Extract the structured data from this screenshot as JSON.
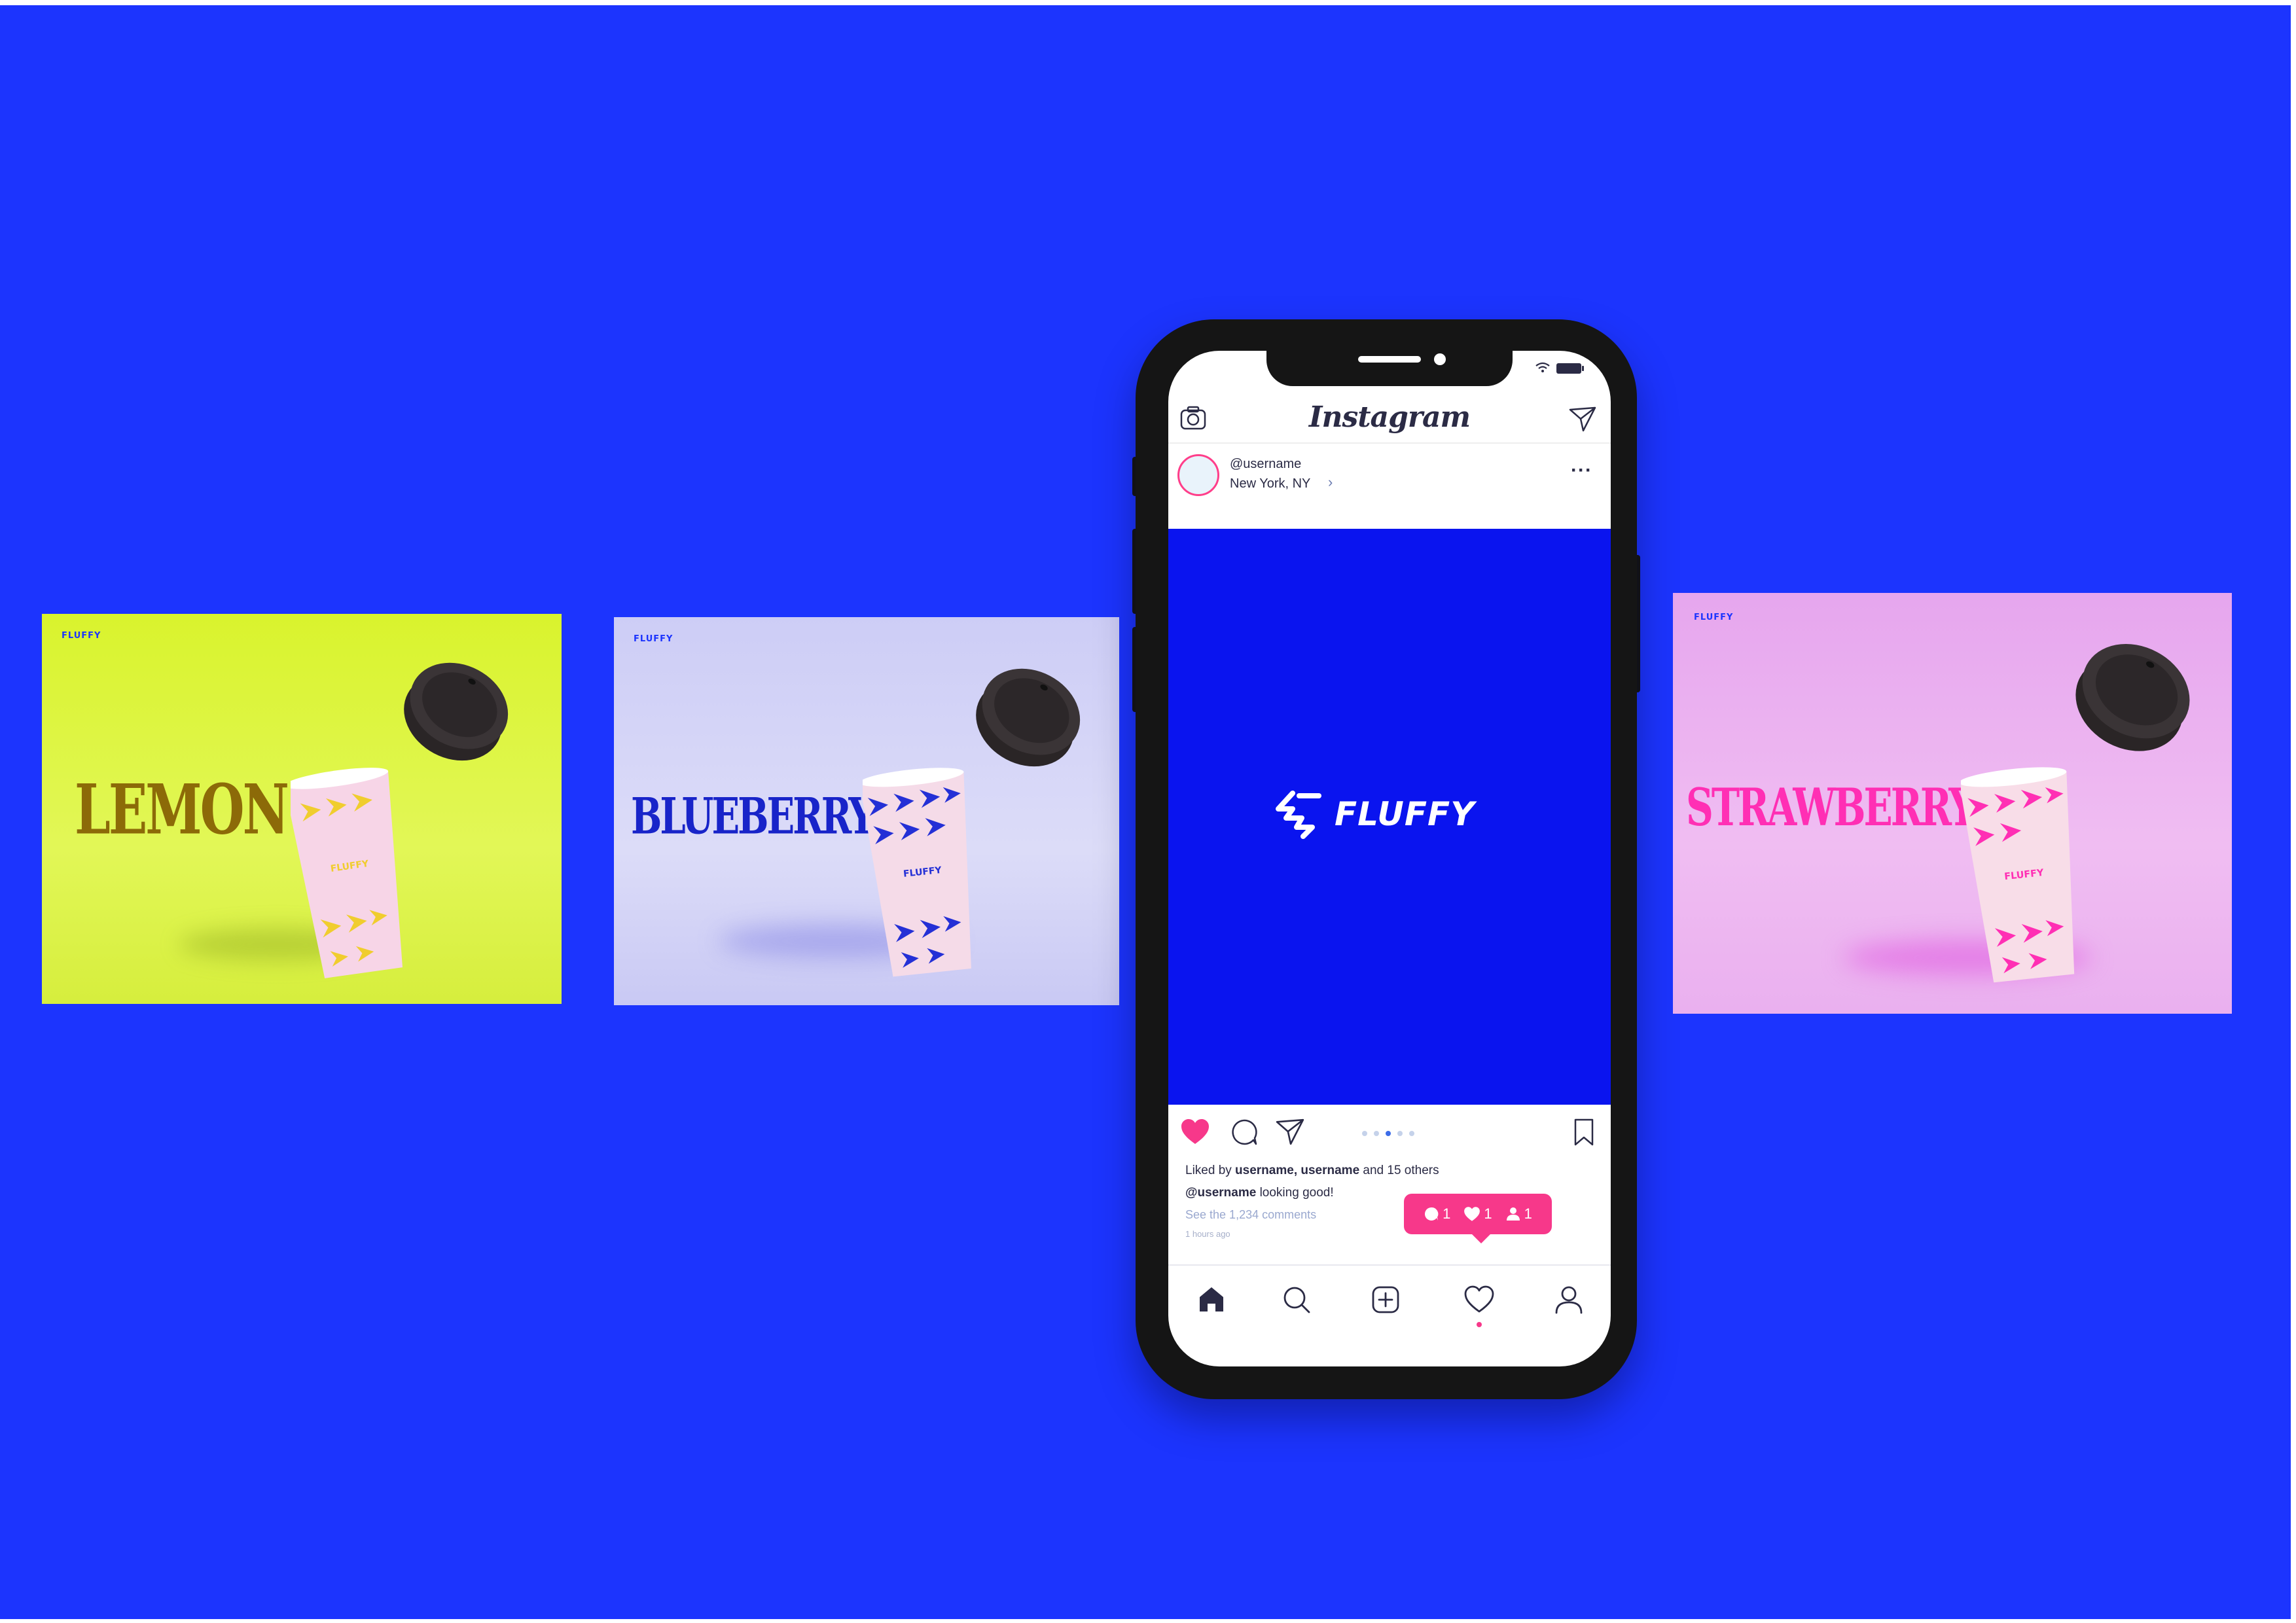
{
  "cards": [
    {
      "brand": "FLUFFY",
      "flavor": "LEMON",
      "background": "#ddf443",
      "flavor_color": "#8c6a08",
      "pattern_color": "#f0cd2e"
    },
    {
      "brand": "FLUFFY",
      "flavor": "BLUEBERRY",
      "background": "#d4d4f7",
      "flavor_color": "#1824c9",
      "pattern_color": "#2430d6"
    },
    {
      "brand": "FLUFFY",
      "flavor": "STRAWBERRY",
      "background": "#ecb4f0",
      "flavor_color": "#ff2fb4",
      "pattern_color": "#ff2fb4"
    }
  ],
  "phone": {
    "app_name": "Instagram",
    "post": {
      "username": "@username",
      "location": "New York, NY",
      "chevron": "›",
      "more": "···",
      "image_brand": "FLUFFY",
      "image_background": "#0a14ef",
      "liked_prefix": "Liked by ",
      "liked_names": "username, username",
      "liked_suffix": " and 15 others",
      "caption_user": "@username",
      "caption_text": " looking good!",
      "comments_link": "See the 1,234 comments",
      "time_ago": "1 hours ago"
    },
    "notification": {
      "comments": "1",
      "likes": "1",
      "followers": "1"
    },
    "icons": {
      "header": [
        "camera-icon",
        "send-icon"
      ],
      "actions": [
        "heart-filled-icon",
        "comment-icon",
        "share-icon",
        "bookmark-icon"
      ],
      "tabs": [
        "home-icon",
        "search-icon",
        "add-post-icon",
        "activity-heart-icon",
        "profile-icon"
      ]
    },
    "colors": {
      "accent": "#f7388a",
      "ink": "#2b2b45"
    }
  },
  "background_color": "#1c34fe"
}
